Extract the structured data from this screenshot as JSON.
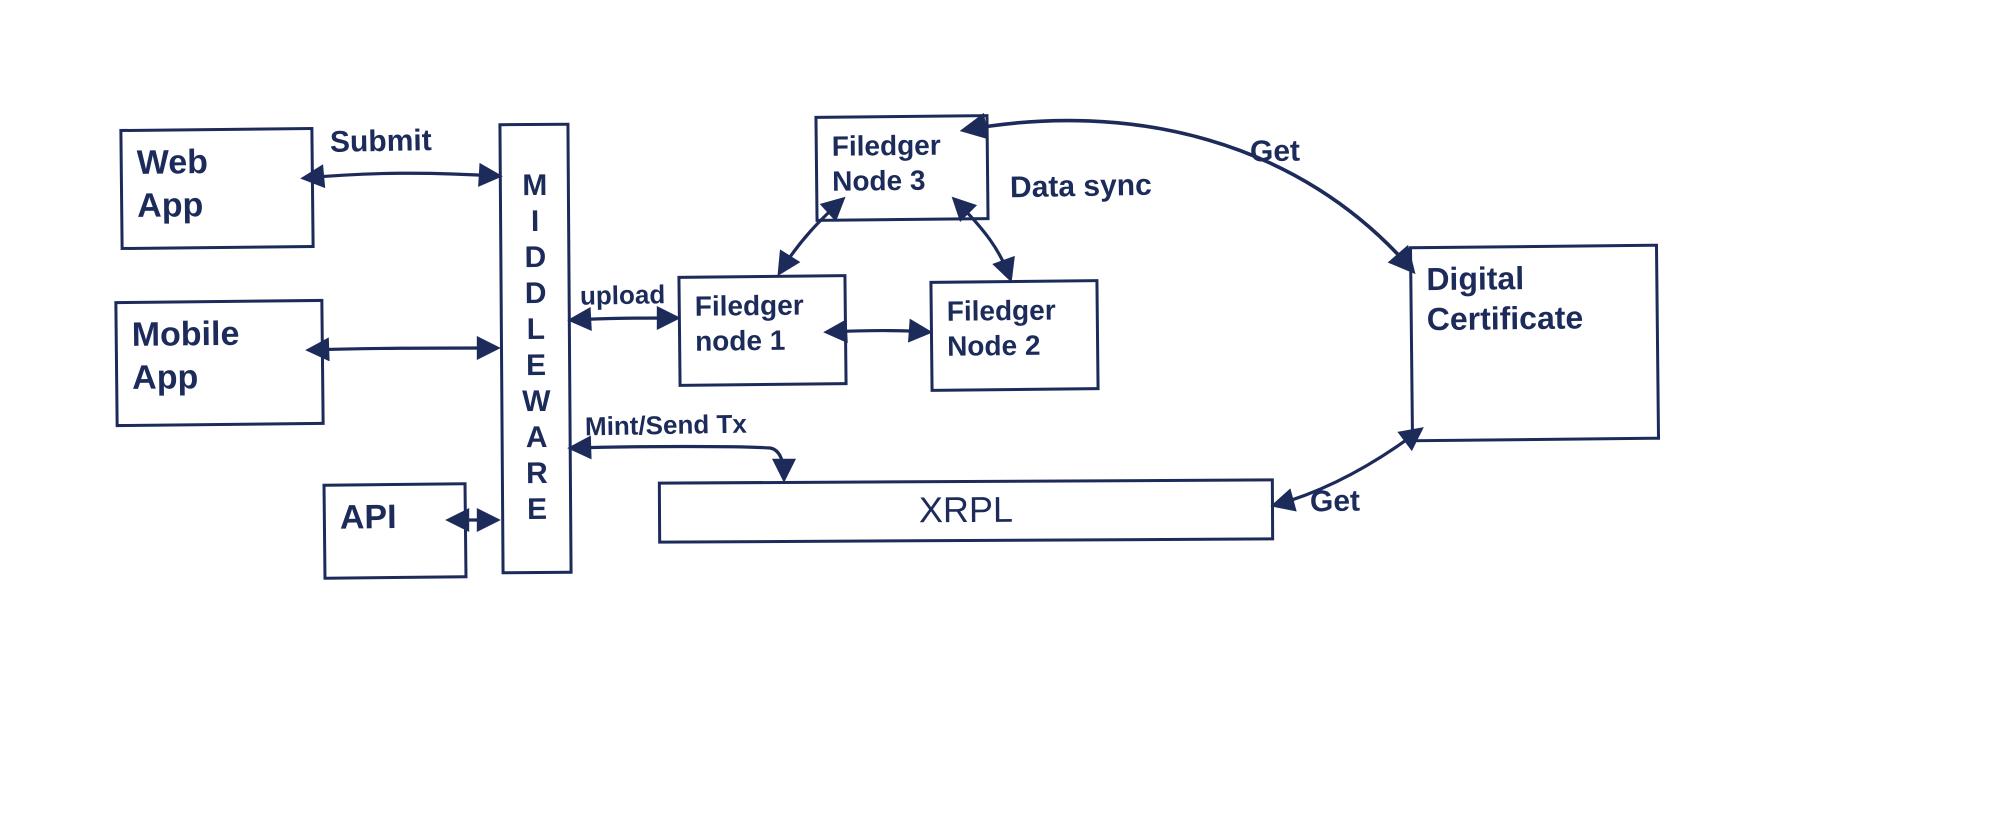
{
  "nodes": {
    "web_app": "Web\nApp",
    "mobile_app": "Mobile\nApp",
    "api": "API",
    "middleware": "MIDDLEWARE",
    "filedger_node_1": "Filedger\nnode 1",
    "filedger_node_2": "Filedger\nNode 2",
    "filedger_node_3": "Filedger\nNode 3",
    "xrpl": "XRPL",
    "digital_certificate": "Digital\nCertificate"
  },
  "edges": {
    "submit": "Submit",
    "upload": "upload",
    "mint_send_tx": "Mint/Send Tx",
    "data_sync": "Data sync",
    "get_top": "Get",
    "get_bottom": "Get"
  }
}
